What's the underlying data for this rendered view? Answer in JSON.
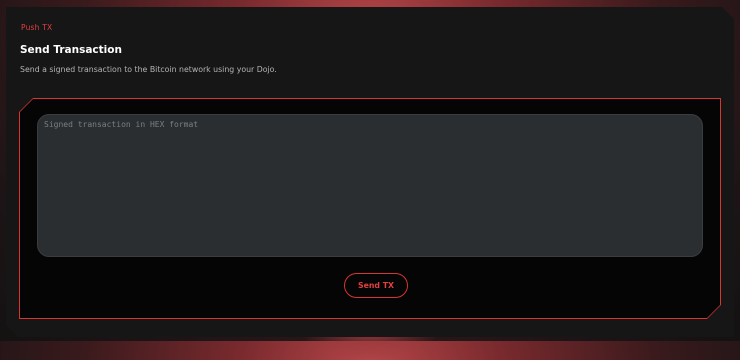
{
  "breadcrumb": "Push TX",
  "page": {
    "title": "Send Transaction",
    "description": "Send a signed transaction to the Bitcoin network using your Dojo."
  },
  "form": {
    "tx_placeholder": "Signed transaction in HEX format",
    "tx_value": "",
    "send_label": "Send TX"
  },
  "colors": {
    "accent": "#d7352f",
    "panel_bg": "#161617",
    "input_bg": "#2b2e31"
  }
}
